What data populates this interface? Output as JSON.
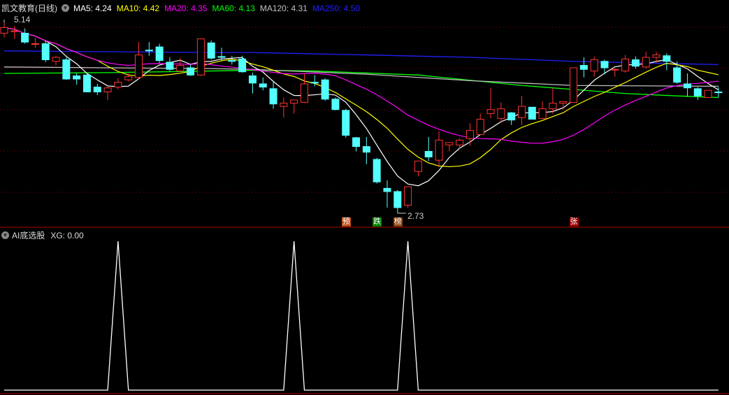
{
  "header": {
    "title": "凯文教育(日线)",
    "ma_labels": [
      {
        "text": "MA5: 4.24",
        "color": "#ffffff"
      },
      {
        "text": "MA10: 4.42",
        "color": "#ffff00"
      },
      {
        "text": "MA20: 4.35",
        "color": "#ff00ff"
      },
      {
        "text": "MA60: 4.13",
        "color": "#00ff00"
      },
      {
        "text": "MA120: 4.31",
        "color": "#c0c0c0"
      },
      {
        "text": "MA250: 4.50",
        "color": "#2020ff"
      }
    ]
  },
  "indicator": {
    "title": "AI底选股",
    "value_label": "XG: 0.00"
  },
  "chart_data": [
    {
      "type": "candlestick",
      "title": "凯文教育(日线)",
      "high_label": "5.14",
      "low_label": "2.73",
      "colors": {
        "up": "#ff3232",
        "down": "#54ffff",
        "grid": "#8b0000"
      },
      "ohlc": [
        [
          4.97,
          5.14,
          4.92,
          5.04
        ],
        [
          4.99,
          5.06,
          4.9,
          5.0
        ],
        [
          4.97,
          5.03,
          4.84,
          4.86
        ],
        [
          4.84,
          4.91,
          4.79,
          4.84
        ],
        [
          4.84,
          4.88,
          4.61,
          4.64
        ],
        [
          4.62,
          4.69,
          4.57,
          4.67
        ],
        [
          4.64,
          4.67,
          4.39,
          4.4
        ],
        [
          4.44,
          4.47,
          4.33,
          4.4
        ],
        [
          4.45,
          4.47,
          4.24,
          4.24
        ],
        [
          4.3,
          4.34,
          4.2,
          4.24
        ],
        [
          4.24,
          4.31,
          4.14,
          4.29
        ],
        [
          4.3,
          4.41,
          4.27,
          4.36
        ],
        [
          4.39,
          4.47,
          4.37,
          4.43
        ],
        [
          4.42,
          4.86,
          4.4,
          4.7
        ],
        [
          4.76,
          4.86,
          4.69,
          4.75
        ],
        [
          4.8,
          4.84,
          4.6,
          4.63
        ],
        [
          4.61,
          4.67,
          4.5,
          4.52
        ],
        [
          4.5,
          4.66,
          4.49,
          4.57
        ],
        [
          4.54,
          4.58,
          4.44,
          4.45
        ],
        [
          4.45,
          4.9,
          4.44,
          4.9
        ],
        [
          4.85,
          4.88,
          4.64,
          4.66
        ],
        [
          4.68,
          4.79,
          4.62,
          4.67
        ],
        [
          4.63,
          4.69,
          4.58,
          4.62
        ],
        [
          4.65,
          4.69,
          4.48,
          4.49
        ],
        [
          4.44,
          4.48,
          4.22,
          4.35
        ],
        [
          4.34,
          4.42,
          4.26,
          4.3
        ],
        [
          4.28,
          4.37,
          4.03,
          4.09
        ],
        [
          4.06,
          4.17,
          3.92,
          4.1
        ],
        [
          4.1,
          4.14,
          3.97,
          4.14
        ],
        [
          4.11,
          4.47,
          4.1,
          4.34
        ],
        [
          4.36,
          4.45,
          4.31,
          4.35
        ],
        [
          4.39,
          4.41,
          4.13,
          4.15
        ],
        [
          4.15,
          4.17,
          4.01,
          4.02
        ],
        [
          4.01,
          4.03,
          3.67,
          3.7
        ],
        [
          3.67,
          3.68,
          3.5,
          3.56
        ],
        [
          3.56,
          3.68,
          3.34,
          3.49
        ],
        [
          3.4,
          3.42,
          3.1,
          3.12
        ],
        [
          3.04,
          3.14,
          2.8,
          3.0
        ],
        [
          3.0,
          3.02,
          2.73,
          2.8
        ],
        [
          2.83,
          3.06,
          2.8,
          3.06
        ],
        [
          3.25,
          3.38,
          3.19,
          3.38
        ],
        [
          3.5,
          3.68,
          3.38,
          3.43
        ],
        [
          3.39,
          3.75,
          3.32,
          3.64
        ],
        [
          3.58,
          3.61,
          3.5,
          3.61
        ],
        [
          3.58,
          3.66,
          3.54,
          3.64
        ],
        [
          3.66,
          3.85,
          3.57,
          3.76
        ],
        [
          3.71,
          3.97,
          3.71,
          3.9
        ],
        [
          3.97,
          4.29,
          3.91,
          4.02
        ],
        [
          3.91,
          4.11,
          3.85,
          4.03
        ],
        [
          3.98,
          3.99,
          3.83,
          3.89
        ],
        [
          3.92,
          4.19,
          3.83,
          4.06
        ],
        [
          4.05,
          4.05,
          3.9,
          3.9
        ],
        [
          3.91,
          4.12,
          3.9,
          4.03
        ],
        [
          4.03,
          4.29,
          3.97,
          4.1
        ],
        [
          4.1,
          4.12,
          4.02,
          4.12
        ],
        [
          4.11,
          4.54,
          4.11,
          4.54
        ],
        [
          4.57,
          4.67,
          4.42,
          4.52
        ],
        [
          4.5,
          4.68,
          4.43,
          4.64
        ],
        [
          4.62,
          4.64,
          4.46,
          4.54
        ],
        [
          4.52,
          4.53,
          4.43,
          4.52
        ],
        [
          4.5,
          4.7,
          4.48,
          4.65
        ],
        [
          4.64,
          4.68,
          4.53,
          4.56
        ],
        [
          4.55,
          4.74,
          4.53,
          4.67
        ],
        [
          4.67,
          4.74,
          4.6,
          4.7
        ],
        [
          4.69,
          4.72,
          4.51,
          4.62
        ],
        [
          4.54,
          4.62,
          4.34,
          4.36
        ],
        [
          4.34,
          4.47,
          4.18,
          4.29
        ],
        [
          4.28,
          4.3,
          4.14,
          4.19
        ],
        [
          4.17,
          4.26,
          4.17,
          4.26
        ],
        [
          4.24,
          4.3,
          4.17,
          4.23
        ]
      ],
      "long_ma": {
        "MA60": {
          "color": "#00ff00",
          "points": [
            [
              0,
              4.47
            ],
            [
              10,
              4.48
            ],
            [
              20,
              4.5
            ],
            [
              24,
              4.51
            ],
            [
              30,
              4.5
            ],
            [
              40,
              4.45
            ],
            [
              50,
              4.32
            ],
            [
              56,
              4.26
            ],
            [
              60,
              4.22
            ],
            [
              65,
              4.19
            ],
            [
              69,
              4.17
            ]
          ]
        },
        "MA120": {
          "color": "#c0c0c0",
          "points": [
            [
              0,
              4.55
            ],
            [
              20,
              4.53
            ],
            [
              24,
              4.52
            ],
            [
              35,
              4.46
            ],
            [
              45,
              4.38
            ],
            [
              55,
              4.32
            ],
            [
              69,
              4.31
            ]
          ]
        },
        "MA250": {
          "color": "#2020ff",
          "points": [
            [
              0,
              4.75
            ],
            [
              20,
              4.73
            ],
            [
              24,
              4.73
            ],
            [
              35,
              4.7
            ],
            [
              45,
              4.67
            ],
            [
              55,
              4.62
            ],
            [
              69,
              4.58
            ]
          ]
        }
      },
      "markers": [
        {
          "index": 33,
          "text": "预",
          "color": "#c05018"
        },
        {
          "index": 36,
          "text": "跌",
          "color": "#008000"
        },
        {
          "index": 38,
          "text": "榜",
          "color": "#8b4513"
        },
        {
          "index": 55,
          "text": "张",
          "color": "#a00000"
        }
      ]
    },
    {
      "type": "line",
      "title": "AI底选股",
      "series": [
        {
          "name": "XG",
          "hits": [
            11,
            28,
            39
          ]
        }
      ],
      "ylim": [
        0,
        1
      ]
    }
  ]
}
